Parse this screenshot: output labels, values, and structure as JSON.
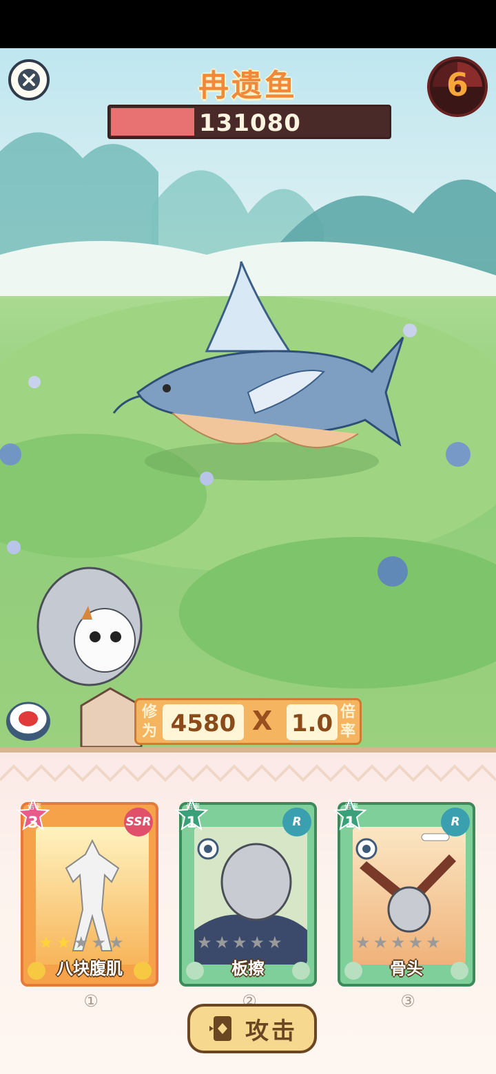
{
  "boss": {
    "name": "冉遗鱼",
    "hp": "131080",
    "hp_fraction": 0.3,
    "turns_left": "6"
  },
  "player": {
    "power_label": "修为",
    "power": "4580",
    "multiply": "X",
    "multiplier": "1.0",
    "multiplier_label": "倍率"
  },
  "cards": [
    {
      "name": "八块腹肌",
      "level": "3",
      "level_label": "倍率",
      "rarity": "SSR",
      "stars_filled": 2,
      "stars_total": 5,
      "index": "①"
    },
    {
      "name": "板擦",
      "level": "1",
      "level_label": "倍率",
      "rarity": "R",
      "stars_filled": 0,
      "stars_total": 5,
      "index": "②"
    },
    {
      "name": "骨头",
      "level": "1",
      "level_label": "倍率",
      "rarity": "R",
      "stars_filled": 0,
      "stars_total": 5,
      "index": "③"
    }
  ],
  "attack_button": "攻击",
  "icons": {
    "close": "close-icon",
    "attack": "card-icon",
    "player_disc": "target-disc-icon"
  }
}
